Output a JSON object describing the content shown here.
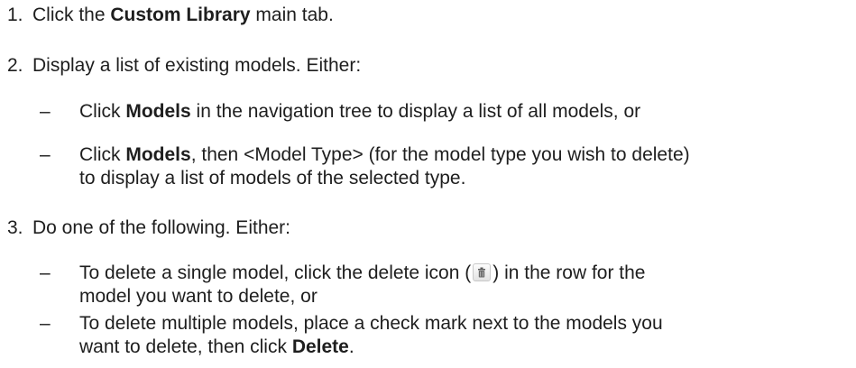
{
  "steps": [
    {
      "number": "1.",
      "pre": "Click the ",
      "bold": "Custom Library",
      "post": " main tab."
    },
    {
      "number": "2.",
      "text": "Display a list of existing models. Either:",
      "subs": [
        {
          "dash": "–",
          "pre": "Click ",
          "bold": "Models",
          "post": " in the navigation tree to display a list of all models, or"
        },
        {
          "dash": "–",
          "pre": "Click ",
          "bold": "Models",
          "post": ", then <Model Type> (for the model type you wish to delete)",
          "line2": "to display a list of models of the selected type."
        }
      ]
    },
    {
      "number": "3.",
      "text": "Do one of the following. Either:",
      "subs": [
        {
          "dash": "–",
          "pre": "To delete a single model, click the delete icon (",
          "icon": "trash-icon",
          "post": ") in the row for the",
          "line2": "model you want to delete, or"
        },
        {
          "dash": "–",
          "line1": "To delete multiple models, place a check mark next to the models you",
          "pre": "want to delete, then click ",
          "bold": "Delete",
          "post": "."
        }
      ]
    }
  ]
}
